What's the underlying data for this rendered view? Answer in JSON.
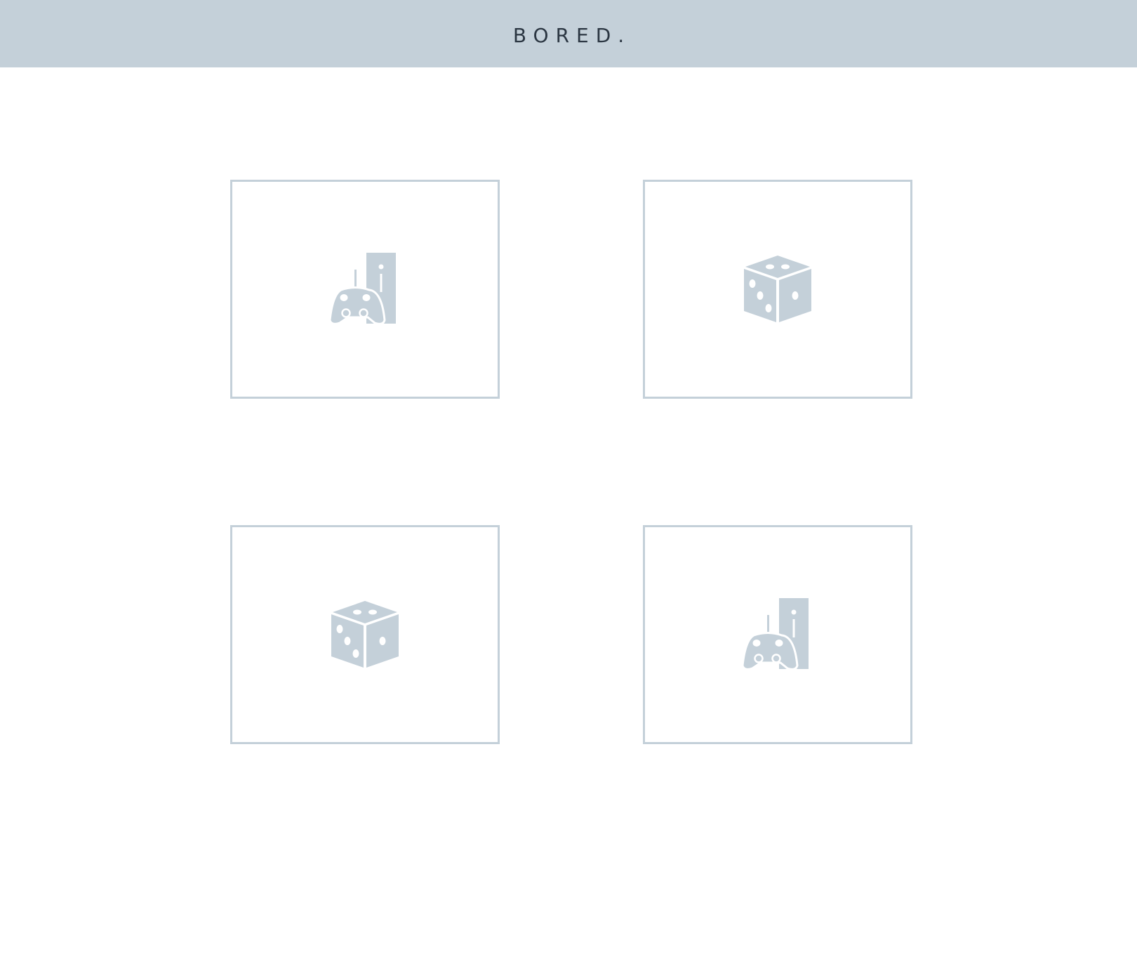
{
  "header": {
    "title": "BORED."
  },
  "colors": {
    "header_bg": "#c4d0d9",
    "brand_text": "#2b3642",
    "card_border": "#c4d0d9",
    "icon_fill": "#c4d0d9"
  },
  "cards": [
    {
      "icon": "video-game-console-icon"
    },
    {
      "icon": "dice-icon"
    },
    {
      "icon": "dice-icon"
    },
    {
      "icon": "video-game-console-icon"
    }
  ]
}
